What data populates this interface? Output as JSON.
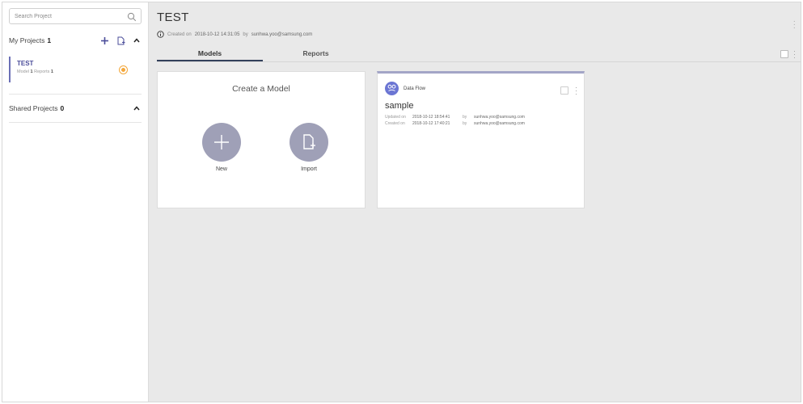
{
  "sidebar": {
    "search": {
      "placeholder": "Search Project"
    },
    "my_projects": {
      "label": "My Projects",
      "count": "1"
    },
    "project": {
      "name": "TEST",
      "models_label": "Model",
      "models_count": "1",
      "reports_label": "Reports",
      "reports_count": "1"
    },
    "shared_projects": {
      "label": "Shared Projects",
      "count": "0"
    }
  },
  "header": {
    "title": "TEST",
    "created_label": "Created on",
    "created_date": "2018-10-12 14:31:05",
    "by_label": "by",
    "created_by": "sunhwa.yoo@samsung.com"
  },
  "tabs": [
    {
      "label": "Models",
      "active": true
    },
    {
      "label": "Reports",
      "active": false
    }
  ],
  "create_card": {
    "title": "Create a Model",
    "new_label": "New",
    "import_label": "Import"
  },
  "model_card": {
    "type": "Data Flow",
    "title": "sample",
    "updated_label": "Updated on",
    "updated_date": "2018-10-12 18:54:41",
    "created_label": "Created on",
    "created_date": "2018-10-12 17:40:21",
    "by_label": "by",
    "updated_by": "sunhwa.yoo@samsung.com",
    "created_by": "sunhwa.yoo@samsung.com"
  },
  "colors": {
    "accent": "#4b4d9a",
    "status_dot": "#f3a73b",
    "action_circle": "#9fa0b7",
    "badge": "#6b75d3"
  },
  "icons": [
    "search-icon",
    "plus-icon",
    "import-icon",
    "chevron-up-icon",
    "info-icon",
    "kebab-icon",
    "dataflow-icon",
    "new-icon",
    "file-import-icon"
  ]
}
